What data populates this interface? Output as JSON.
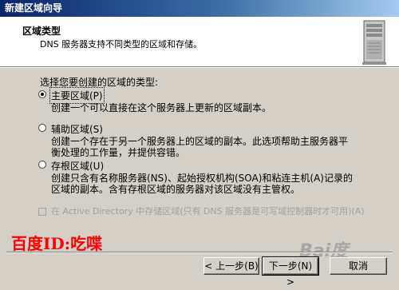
{
  "window": {
    "title": "新建区域向导"
  },
  "header": {
    "title": "区域类型",
    "subtitle": "DNS 服务器支持不同类型的区域和存储。"
  },
  "prompt": "选择您要创建的区域的类型:",
  "options": [
    {
      "label": "主要区域(P)",
      "description": "创建一个可以直接在这个服务器上更新的区域副本。",
      "selected": true
    },
    {
      "label": "辅助区域(S)",
      "description": "创建一个存在于另一个服务器上的区域的副本。此选项帮助主服务器平衡处理的工作量，并提供容错。",
      "selected": false
    },
    {
      "label": "存根区域(U)",
      "description": "创建只含有名称服务器(NS)、起始授权机构(SOA)和粘连主机(A)记录的区域的副本。含有存根区域的服务器对该区域没有主管权。",
      "selected": false
    }
  ],
  "ad_storage": {
    "label": "在 Active Directory 中存储区域(只有 DNS 服务器是可写域控制器时才可用)(A)",
    "checked": false,
    "enabled": false
  },
  "watermark": "百度ID:吃喋",
  "site_mark": "Bai度",
  "buttons": {
    "back": "< 上一步(B)",
    "next": "下一步(N) >",
    "cancel": "取消"
  }
}
